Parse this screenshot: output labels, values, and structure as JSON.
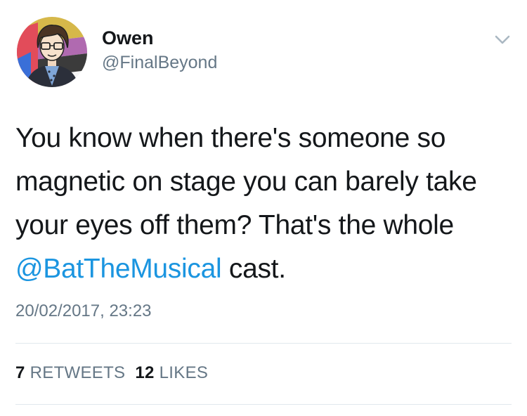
{
  "author": {
    "display_name": "Owen",
    "handle": "@FinalBeyond"
  },
  "tweet": {
    "text_before": "You know when there's someone so magnetic on stage you can barely take your eyes off them? That's the whole ",
    "mention": "@BatTheMusical",
    "text_after": " cast.",
    "timestamp": "20/02/2017, 23:23"
  },
  "stats": {
    "retweets_count": "7",
    "retweets_label": "RETWEETS",
    "likes_count": "12",
    "likes_label": "LIKES"
  },
  "icons": {
    "menu": "chevron-down-icon"
  },
  "colors": {
    "link": "#1b95e0",
    "secondary_text": "#657786",
    "primary_text": "#14171a",
    "divider": "#e1e8ed"
  }
}
